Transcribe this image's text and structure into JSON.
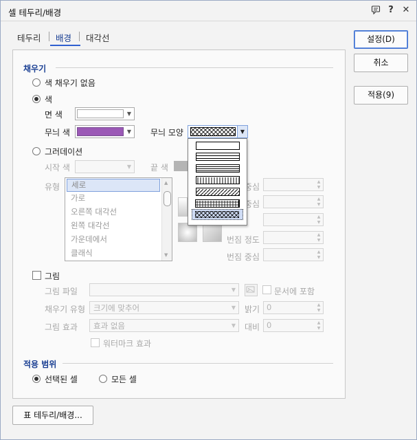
{
  "window": {
    "title": "셀 테두리/배경"
  },
  "titlebar_icons": [
    "comment-icon",
    "help-icon",
    "close-icon"
  ],
  "titlebar_glyphs": {
    "help": "?",
    "close": "✕"
  },
  "tabs": [
    {
      "label": "테두리",
      "active": false
    },
    {
      "label": "배경",
      "active": true
    },
    {
      "label": "대각선",
      "active": false
    }
  ],
  "buttons": {
    "ok": "설정(D)",
    "cancel": "취소",
    "apply": "적용(9)",
    "table_border": "표 테두리/배경..."
  },
  "fill": {
    "section_title": "채우기",
    "no_fill_label": "색 채우기 없음",
    "color_label": "색",
    "face_color_label": "면 색",
    "pattern_color_label": "무늬 색",
    "pattern_color": "#9b59b6",
    "pattern_shape_label": "무늬 모양",
    "selected": "color",
    "pattern_options": [
      "none",
      "horizontal",
      "vertical",
      "forward-diagonal",
      "back-diagonal",
      "cross",
      "diagonal-cross"
    ],
    "selected_pattern": "diagonal-cross"
  },
  "gradient": {
    "label": "그러데이션",
    "start_color_label": "시작 색",
    "end_color_label": "끝 색",
    "type_label": "유형",
    "type_options": [
      "세로",
      "가로",
      "오른쪽 대각선",
      "왼쪽 대각선",
      "가운데에서",
      "클래식"
    ],
    "selected_type": "세로",
    "center_label": "중심",
    "blur_level_label": "번짐 정도",
    "blur_center_label": "번짐 중심"
  },
  "picture": {
    "label": "그림",
    "file_label": "그림 파일",
    "include_doc_label": "문서에 포함",
    "fill_type_label": "채우기 유형",
    "fill_type_value": "크기에 맞추어",
    "brightness_label": "밝기",
    "brightness_value": "0",
    "effect_label": "그림 효과",
    "effect_value": "효과 없음",
    "contrast_label": "대비",
    "contrast_value": "0",
    "watermark_label": "워터마크 효과"
  },
  "scope": {
    "section_title": "적용 범위",
    "selected_cells_label": "선택된 셀",
    "all_cells_label": "모든 셀",
    "selected": "selected_cells"
  }
}
